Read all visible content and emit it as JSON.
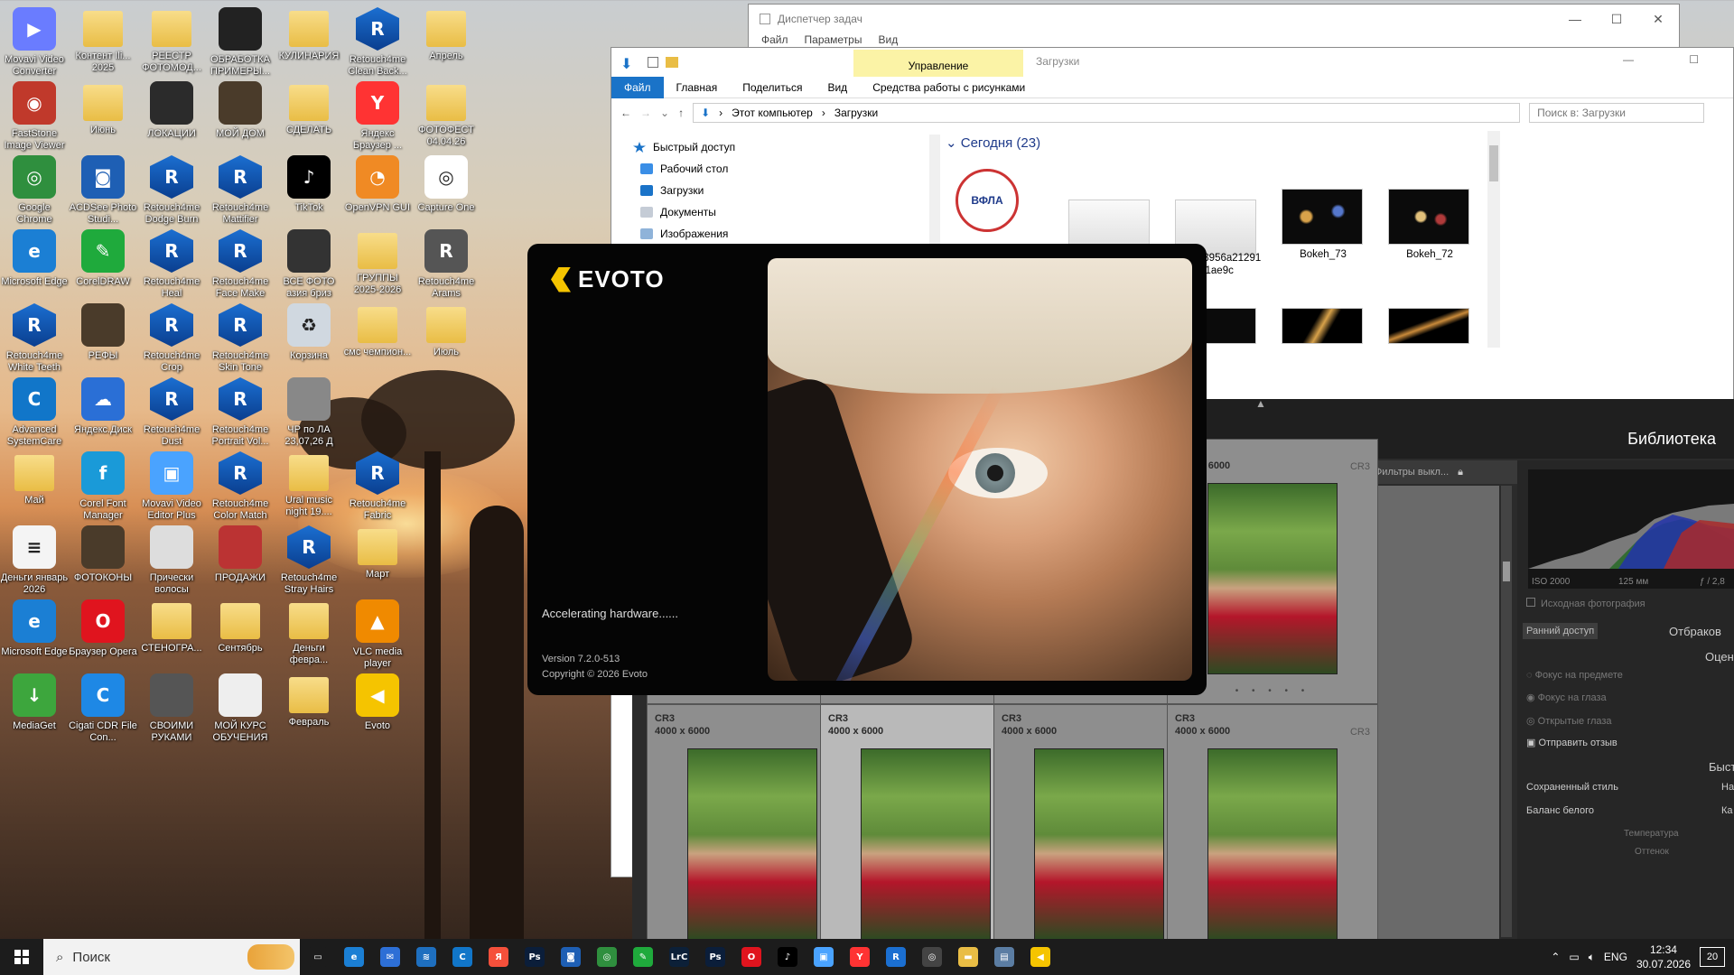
{
  "desktop": {
    "icons": [
      {
        "label": "Movavi Video Converter",
        "glyph": "▶",
        "color": "#6a7cff",
        "col": 0,
        "row": 0
      },
      {
        "label": "Контент Ili... 2025",
        "glyph": "",
        "color": "folder",
        "col": 1,
        "row": 0
      },
      {
        "label": "РЕЕСТР ФОТОМОД...",
        "glyph": "",
        "color": "folder",
        "col": 2,
        "row": 0
      },
      {
        "label": "ОБРАБОТКА ПРИМЕРЫ...",
        "glyph": "",
        "color": "#222",
        "col": 3,
        "row": 0
      },
      {
        "label": "КУЛИНАРИЯ",
        "glyph": "",
        "color": "folder",
        "col": 4,
        "row": 0
      },
      {
        "label": "Retouch4me Clean Back...",
        "glyph": "R",
        "color": "r4m",
        "col": 5,
        "row": 0
      },
      {
        "label": "Апрель",
        "glyph": "",
        "color": "folder",
        "col": 6,
        "row": 0
      },
      {
        "label": "FastStone Image Viewer",
        "glyph": "◉",
        "color": "#c0392b",
        "col": 0,
        "row": 1
      },
      {
        "label": "Июнь",
        "glyph": "",
        "color": "folder",
        "col": 1,
        "row": 1
      },
      {
        "label": "ЛОКАЦИИ",
        "glyph": "",
        "color": "#2b2b2b",
        "col": 2,
        "row": 1
      },
      {
        "label": "МОЙ ДОМ",
        "glyph": "",
        "color": "#4a3b2a",
        "col": 3,
        "row": 1
      },
      {
        "label": "СДЕЛАТЬ",
        "glyph": "",
        "color": "folder",
        "col": 4,
        "row": 1
      },
      {
        "label": "Яндекс Браузер ...",
        "glyph": "Y",
        "color": "#ff3333",
        "col": 5,
        "row": 1
      },
      {
        "label": "ФОТОФЕСТ 04.04.26",
        "glyph": "",
        "color": "folder",
        "col": 6,
        "row": 1
      },
      {
        "label": "Google Chrome",
        "glyph": "◎",
        "color": "#2f8f3e",
        "col": 0,
        "row": 2
      },
      {
        "label": "ACDSee Photo Studi...",
        "glyph": "◙",
        "color": "#1e5fb4",
        "col": 1,
        "row": 2
      },
      {
        "label": "Retouch4me Dodge Burn",
        "glyph": "R",
        "color": "r4m",
        "col": 2,
        "row": 2
      },
      {
        "label": "Retouch4me Mattifier",
        "glyph": "R",
        "color": "r4m",
        "col": 3,
        "row": 2
      },
      {
        "label": "TikTok",
        "glyph": "♪",
        "color": "#000",
        "col": 4,
        "row": 2
      },
      {
        "label": "OpenVPN GUI",
        "glyph": "◔",
        "color": "#f08a24",
        "col": 5,
        "row": 2
      },
      {
        "label": "Capture One",
        "glyph": "◎",
        "color": "#ffffff",
        "col": 6,
        "row": 2
      },
      {
        "label": "Microsoft Edge",
        "glyph": "e",
        "color": "#1b7fd4",
        "col": 0,
        "row": 3
      },
      {
        "label": "CorelDRAW",
        "glyph": "✎",
        "color": "#1faa3c",
        "col": 1,
        "row": 3
      },
      {
        "label": "Retouch4me Heal",
        "glyph": "R",
        "color": "r4m",
        "col": 2,
        "row": 3
      },
      {
        "label": "Retouch4me Face Make",
        "glyph": "R",
        "color": "r4m",
        "col": 3,
        "row": 3
      },
      {
        "label": "ВСЕ ФОТО азия бриз",
        "glyph": "",
        "color": "#333",
        "col": 4,
        "row": 3
      },
      {
        "label": "ГРУППЫ 2025-2026",
        "glyph": "",
        "color": "folder",
        "col": 5,
        "row": 3
      },
      {
        "label": "Retouch4me Arams",
        "glyph": "R",
        "color": "#555",
        "col": 6,
        "row": 3
      },
      {
        "label": "Retouch4me White Teeth",
        "glyph": "R",
        "color": "r4m",
        "col": 0,
        "row": 4
      },
      {
        "label": "РЕФЫ",
        "glyph": "",
        "color": "#4a3b2a",
        "col": 1,
        "row": 4
      },
      {
        "label": "Retouch4me Crop",
        "glyph": "R",
        "color": "r4m",
        "col": 2,
        "row": 4
      },
      {
        "label": "Retouch4me Skin Tone",
        "glyph": "R",
        "color": "r4m",
        "col": 3,
        "row": 4
      },
      {
        "label": "Корзина",
        "glyph": "♻",
        "color": "#d0d8e0",
        "col": 4,
        "row": 4
      },
      {
        "label": "смс чемпион...",
        "glyph": "",
        "color": "folder",
        "col": 5,
        "row": 4
      },
      {
        "label": "Июль",
        "glyph": "",
        "color": "folder",
        "col": 6,
        "row": 4
      },
      {
        "label": "Advanced SystemCare",
        "glyph": "C",
        "color": "#1176c9",
        "col": 0,
        "row": 5
      },
      {
        "label": "Яндекс.Диск",
        "glyph": "☁",
        "color": "#2a6fd6",
        "col": 1,
        "row": 5
      },
      {
        "label": "Retouch4me Dust",
        "glyph": "R",
        "color": "r4m",
        "col": 2,
        "row": 5
      },
      {
        "label": "Retouch4me Portrait Vol...",
        "glyph": "R",
        "color": "r4m",
        "col": 3,
        "row": 5
      },
      {
        "label": "ЧР по ЛА 23,07,26 Д",
        "glyph": "",
        "color": "#888",
        "col": 4,
        "row": 5
      },
      {
        "label": "Май",
        "glyph": "",
        "color": "folder",
        "col": 0,
        "row": 6
      },
      {
        "label": "Corel Font Manager",
        "glyph": "f",
        "color": "#1a9ad8",
        "col": 1,
        "row": 6
      },
      {
        "label": "Movavi Video Editor Plus",
        "glyph": "▣",
        "color": "#4aa3ff",
        "col": 2,
        "row": 6
      },
      {
        "label": "Retouch4me Color Match",
        "glyph": "R",
        "color": "r4m",
        "col": 3,
        "row": 6
      },
      {
        "label": "Ural music night 19....",
        "glyph": "",
        "color": "folder",
        "col": 4,
        "row": 6
      },
      {
        "label": "Retouch4me Fabric",
        "glyph": "R",
        "color": "r4m",
        "col": 5,
        "row": 6
      },
      {
        "label": "Деньги январь 2026",
        "glyph": "≡",
        "color": "#f4f4f4",
        "col": 0,
        "row": 7
      },
      {
        "label": "ФОТОКОНЫ",
        "glyph": "",
        "color": "#4a3b2a",
        "col": 1,
        "row": 7
      },
      {
        "label": "Прически волосы",
        "glyph": "",
        "color": "#ddd",
        "col": 2,
        "row": 7
      },
      {
        "label": "ПРОДАЖИ",
        "glyph": "",
        "color": "#b33",
        "col": 3,
        "row": 7
      },
      {
        "label": "Retouch4me Stray Hairs",
        "glyph": "R",
        "color": "r4m",
        "col": 4,
        "row": 7
      },
      {
        "label": "Март",
        "glyph": "",
        "color": "folder",
        "col": 5,
        "row": 7
      },
      {
        "label": "Microsoft Edge",
        "glyph": "e",
        "color": "#1b7fd4",
        "col": 0,
        "row": 8
      },
      {
        "label": "Браузер Opera",
        "glyph": "O",
        "color": "#e0141e",
        "col": 1,
        "row": 8
      },
      {
        "label": "СТЕНОГРА...",
        "glyph": "",
        "color": "folder",
        "col": 2,
        "row": 8
      },
      {
        "label": "Сентябрь",
        "glyph": "",
        "color": "folder",
        "col": 3,
        "row": 8
      },
      {
        "label": "Деньги февра...",
        "glyph": "",
        "color": "folder",
        "col": 4,
        "row": 8
      },
      {
        "label": "VLC media player",
        "glyph": "▲",
        "color": "#f08a00",
        "col": 5,
        "row": 8
      },
      {
        "label": "MediaGet",
        "glyph": "↓",
        "color": "#3da63d",
        "col": 0,
        "row": 9
      },
      {
        "label": "Cigati CDR File Con...",
        "glyph": "C",
        "color": "#1e88e5",
        "col": 1,
        "row": 9
      },
      {
        "label": "СВОИМИ РУКАМИ",
        "glyph": "",
        "color": "#555",
        "col": 2,
        "row": 9
      },
      {
        "label": "МОЙ КУРС ОБУЧЕНИЯ",
        "glyph": "",
        "color": "#eee",
        "col": 3,
        "row": 9
      },
      {
        "label": "Февраль",
        "glyph": "",
        "color": "folder",
        "col": 4,
        "row": 9
      },
      {
        "label": "Evoto",
        "glyph": "◀",
        "color": "#f5c400",
        "col": 5,
        "row": 9
      }
    ]
  },
  "task_manager": {
    "title": "Диспетчер задач",
    "menu": [
      "Файл",
      "Параметры",
      "Вид"
    ]
  },
  "explorer": {
    "manage_label": "Управление",
    "title": "Загрузки",
    "tabs": [
      "Файл",
      "Главная",
      "Поделиться",
      "Вид",
      "Средства работы с рисунками"
    ],
    "path": [
      "Этот компьютер",
      "Загрузки"
    ],
    "search_placeholder": "Поиск в: Загрузки",
    "nav": [
      "Быстрый доступ",
      "Рабочий стол",
      "Загрузки",
      "Документы",
      "Изображения"
    ],
    "group": "Сегодня (23)",
    "files": [
      {
        "name": "",
        "kind": "logo"
      },
      {
        "name": "",
        "kind": "screen"
      },
      {
        "name": "fbc8098956a2129151ae9c",
        "kind": "screen"
      },
      {
        "name": "Bokeh_73",
        "kind": "bokeh"
      },
      {
        "name": "Bokeh_72",
        "kind": "bokeh"
      }
    ],
    "logo_text": "ВФЛА"
  },
  "lightroom": {
    "module": "Библиотека",
    "filter": "Фильтры выкл...",
    "ext": "CR3",
    "size": "4000 x 6000",
    "histogram": {
      "iso": "ISO 2000",
      "focal": "125 мм",
      "aperture": "ƒ / 2,8"
    },
    "original_photo": "Исходная фотография",
    "early_access": "Ранний доступ",
    "reject": "Отбраков",
    "rate": "Оцен",
    "focus_subject": "Фокус на предмете",
    "focus_eyes": "Фокус на глаза",
    "open_eyes": "Открытые глаза",
    "feedback": "Отправить отзыв",
    "quick": "Быст",
    "saved_style": "Сохраненный стиль",
    "white_balance": "Баланс белого",
    "temperature": "Температура",
    "tint": "Оттенок",
    "saved_style_value": "На",
    "wb_value": "Ка"
  },
  "evoto": {
    "brand": "EVOTO",
    "status": "Accelerating hardware......",
    "version": "Version 7.2.0-513",
    "copyright": "Copyright © 2026 Evoto"
  },
  "taskbar": {
    "search": "Поиск",
    "apps": [
      {
        "name": "task-view-icon",
        "glyph": "▭",
        "color": "#1c1c1c"
      },
      {
        "name": "edge-icon",
        "glyph": "e",
        "color": "#1b7fd4"
      },
      {
        "name": "mail-icon",
        "glyph": "✉",
        "color": "#2d6fd6"
      },
      {
        "name": "ide-icon",
        "glyph": "≋",
        "color": "#1e6fbf"
      },
      {
        "name": "systemcare-icon",
        "glyph": "C",
        "color": "#1176c9"
      },
      {
        "name": "yandex-icon",
        "glyph": "Я",
        "color": "#f5503b"
      },
      {
        "name": "photoshop-icon",
        "glyph": "Ps",
        "color": "#0b1e3a"
      },
      {
        "name": "acdsee-icon",
        "glyph": "◙",
        "color": "#1e5fb4"
      },
      {
        "name": "chrome-icon",
        "glyph": "◎",
        "color": "#2f8f3e"
      },
      {
        "name": "coreldraw-icon",
        "glyph": "✎",
        "color": "#1faa3c"
      },
      {
        "name": "lightroom-icon",
        "glyph": "LrC",
        "color": "#0c2038"
      },
      {
        "name": "photoshop2-icon",
        "glyph": "Ps",
        "color": "#0b1e3a"
      },
      {
        "name": "opera-icon",
        "glyph": "O",
        "color": "#e0141e"
      },
      {
        "name": "tiktok-icon",
        "glyph": "♪",
        "color": "#000"
      },
      {
        "name": "movavi-icon",
        "glyph": "▣",
        "color": "#4aa3ff"
      },
      {
        "name": "yandex-browser-icon",
        "glyph": "Y",
        "color": "#ff3333"
      },
      {
        "name": "retouch4me-icon",
        "glyph": "R",
        "color": "#1b6fd1"
      },
      {
        "name": "capture-one-icon",
        "glyph": "◎",
        "color": "#444"
      },
      {
        "name": "file-explorer-icon",
        "glyph": "▬",
        "color": "#e9bd45"
      },
      {
        "name": "control-panel-icon",
        "glyph": "▤",
        "color": "#5b7da3"
      },
      {
        "name": "evoto-icon",
        "glyph": "◀",
        "color": "#f5c400"
      }
    ],
    "lang": "ENG",
    "time": "12:34",
    "date": "30.07.2026",
    "notifications": "20"
  }
}
